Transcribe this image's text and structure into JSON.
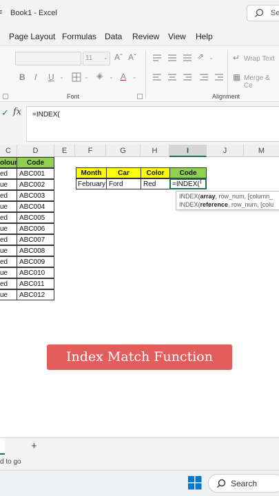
{
  "window": {
    "title": "Book1  -  Excel",
    "left_fragment": "≡",
    "search_placeholder": "Se"
  },
  "menu": [
    "Page Layout",
    "Formulas",
    "Data",
    "Review",
    "View",
    "Help"
  ],
  "ribbon": {
    "font_size": "11",
    "bold": "B",
    "italic": "I",
    "underline": "U",
    "wrap_text": "Wrap Text",
    "merge": "Merge & Ce",
    "font_group": "Font",
    "alignment_group": "Alignment"
  },
  "formula_bar": {
    "fx": "fx",
    "check": "✓",
    "formula": "=INDEX("
  },
  "columns": [
    "C",
    "D",
    "E",
    "F",
    "G",
    "H",
    "I",
    "J",
    "M"
  ],
  "selected_column": "I",
  "left_table": {
    "headers": [
      "olour",
      "Code"
    ],
    "rows": [
      [
        "ed",
        "ABC001"
      ],
      [
        "ue",
        "ABC002"
      ],
      [
        "ed",
        "ABC003"
      ],
      [
        "ue",
        "ABC004"
      ],
      [
        "ed",
        "ABC005"
      ],
      [
        "ue",
        "ABC006"
      ],
      [
        "ed",
        "ABC007"
      ],
      [
        "ue",
        "ABC008"
      ],
      [
        "ed",
        "ABC009"
      ],
      [
        "ue",
        "ABC010"
      ],
      [
        "ed",
        "ABC011"
      ],
      [
        "ue",
        "ABC012"
      ]
    ]
  },
  "lookup_table": {
    "headers": [
      "Month",
      "Car",
      "Color",
      "Code"
    ],
    "values": [
      "February",
      "Ford",
      "Red",
      "=INDEX("
    ]
  },
  "autocomplete": {
    "line1_fn": "INDEX(",
    "line1_bold": "array",
    "line1_rest": ", row_num, [column_",
    "line2_fn": "INDEX(",
    "line2_bold": "reference",
    "line2_rest": ", row_num, [colu"
  },
  "banner": "Index Match Function",
  "sheet_tabs": {
    "add": "+"
  },
  "status": "d to go",
  "taskbar": {
    "search": "Search"
  },
  "colors": {
    "header_yellow": "#ffff00",
    "header_green": "#92d050",
    "banner": "#e35d5d",
    "excel_green": "#1e7145",
    "windows_blue": "#0078d4"
  }
}
